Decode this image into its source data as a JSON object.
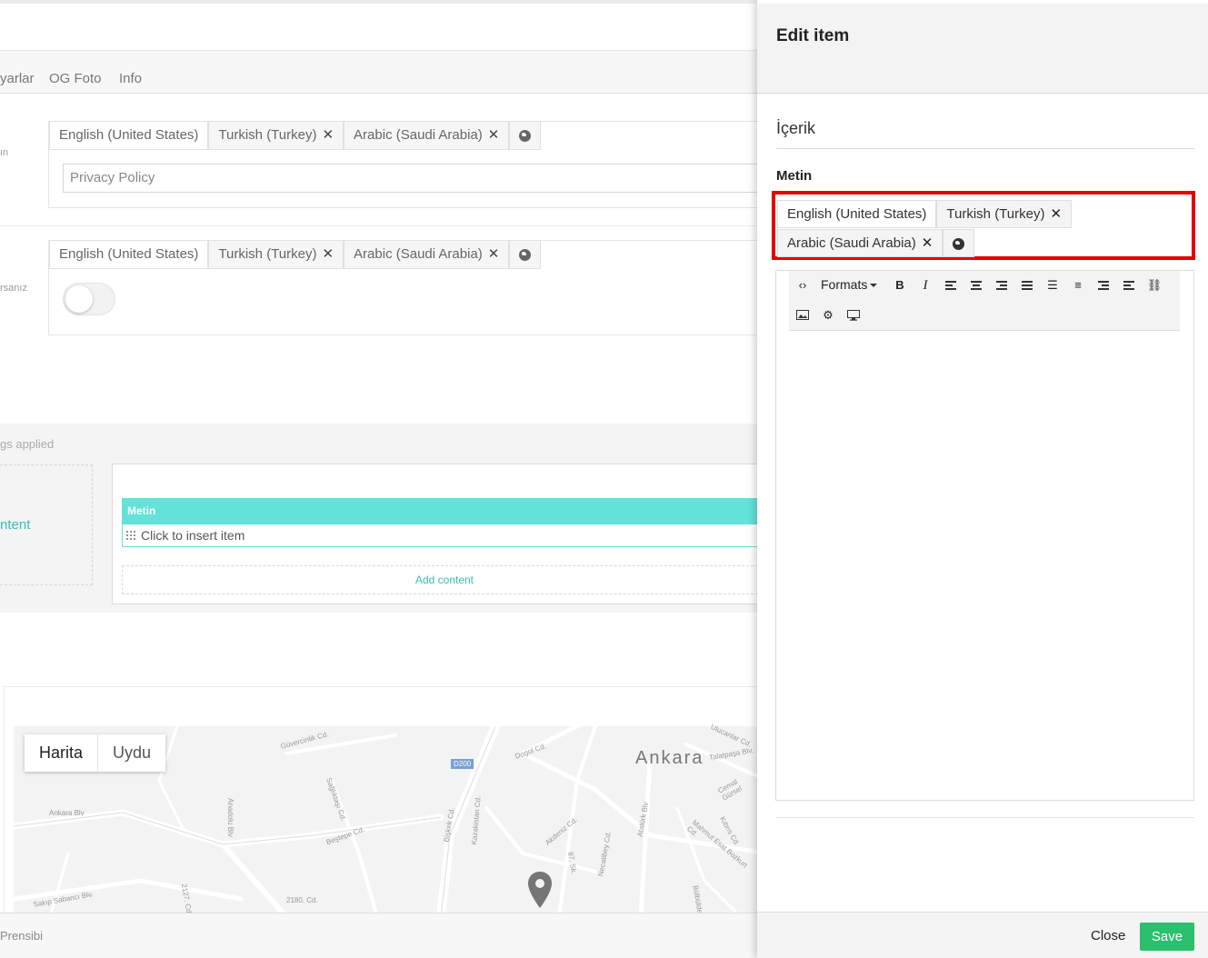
{
  "background": {
    "tabs": [
      "yarlar",
      "OG Foto",
      "Info"
    ],
    "cut_labels": [
      "ın",
      "rsanız"
    ],
    "lang_tabs": [
      "English (United States)",
      "Turkish (Turkey)",
      "Arabic (Saudi Arabia)"
    ],
    "title_field_value": "Privacy Policy",
    "applied_text": "gs applied",
    "content_link": "ntent",
    "grid": {
      "cell_label": "Metin",
      "insert_item": "Click to insert item",
      "add_content": "Add content"
    },
    "map": {
      "type_map": "Harita",
      "type_satellite": "Uydu",
      "city": "Ankara",
      "road_badge": "D200",
      "labels": [
        "Güvercinlik Cd.",
        "Dogol Cd.",
        "Ulucanlar Cd.",
        "Talatpaşa Blv.",
        "Cemal Gürsel",
        "Ankara Blv",
        "Anadolu Blv",
        "Sağlıktaşı Cd.",
        "Beştepe Cd.",
        "Bişkek Cd.",
        "Kazakistan Cd.",
        "Akdeniz Cd.",
        "Atatürk Blv",
        "Mahmut Esat Bozkurt Cd.",
        "Kıbrıs Cd.",
        "Necatibey Cd.",
        "Sakıp Sabancı Blv.",
        "2180. Cd.",
        "2127. Cd.",
        "87. Sk.",
        "Bülbülde"
      ]
    },
    "footer_text": "Prensibi"
  },
  "drawer": {
    "title": "Edit item",
    "section": "İçerik",
    "field_label": "Metin",
    "lang_tabs": [
      "English (United States)",
      "Turkish (Turkey)",
      "Arabic (Saudi Arabia)"
    ],
    "toolbar": {
      "formats": "Formats",
      "bold": "B",
      "italic": "I",
      "icons": [
        "source-code-icon",
        "bold-icon",
        "italic-icon",
        "align-left-icon",
        "align-center-icon",
        "align-right-icon",
        "align-justify-icon",
        "bullet-list-icon",
        "numbered-list-icon",
        "outdent-icon",
        "indent-icon",
        "link-icon",
        "image-icon",
        "macro-icon",
        "embed-icon"
      ]
    },
    "close_label": "Close",
    "save_label": "Save"
  },
  "colors": {
    "accent_teal": "#62e2d8",
    "link_teal": "#35c1b1",
    "save_green": "#2bbf6e",
    "highlight_red": "#e60000"
  }
}
